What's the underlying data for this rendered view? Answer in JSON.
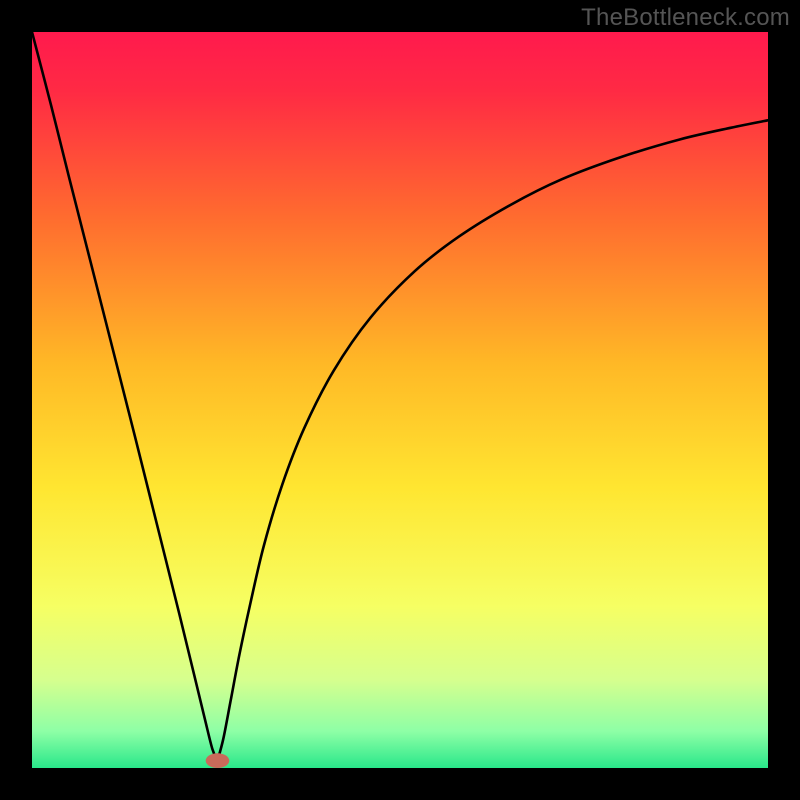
{
  "watermark": "TheBottleneck.com",
  "chart_data": {
    "type": "line",
    "title": "",
    "xlabel": "",
    "ylabel": "",
    "xlim": [
      0,
      100
    ],
    "ylim": [
      0,
      100
    ],
    "grid": false,
    "legend": false,
    "background_gradient": {
      "stops": [
        {
          "t": 0.0,
          "color": "#ff1a4d"
        },
        {
          "t": 0.08,
          "color": "#ff2a44"
        },
        {
          "t": 0.25,
          "color": "#ff6b2f"
        },
        {
          "t": 0.45,
          "color": "#ffb826"
        },
        {
          "t": 0.62,
          "color": "#ffe631"
        },
        {
          "t": 0.78,
          "color": "#f6ff63"
        },
        {
          "t": 0.88,
          "color": "#d6ff8e"
        },
        {
          "t": 0.95,
          "color": "#8effa6"
        },
        {
          "t": 1.0,
          "color": "#29e78a"
        }
      ]
    },
    "marker": {
      "x": 25.2,
      "y": 1.0,
      "rx": 1.6,
      "ry": 1.0,
      "color": "#c96a5a"
    },
    "series": [
      {
        "name": "left-branch",
        "x": [
          0.0,
          2.6,
          5.0,
          8.0,
          11.0,
          14.0,
          17.0,
          20.0,
          22.0,
          23.5,
          24.5,
          25.2
        ],
        "y": [
          100.0,
          90.0,
          80.4,
          68.6,
          56.8,
          45.0,
          33.0,
          21.0,
          12.8,
          6.6,
          2.6,
          1.0
        ]
      },
      {
        "name": "right-branch",
        "x": [
          25.2,
          26.0,
          27.0,
          28.2,
          29.7,
          31.5,
          34.0,
          37.0,
          41.0,
          46.0,
          52.0,
          58.0,
          65.0,
          72.0,
          80.0,
          88.0,
          95.0,
          100.0
        ],
        "y": [
          1.0,
          4.0,
          9.2,
          15.5,
          22.5,
          30.2,
          38.5,
          46.2,
          54.0,
          61.2,
          67.5,
          72.2,
          76.5,
          80.0,
          83.0,
          85.4,
          87.0,
          88.0
        ]
      }
    ]
  }
}
